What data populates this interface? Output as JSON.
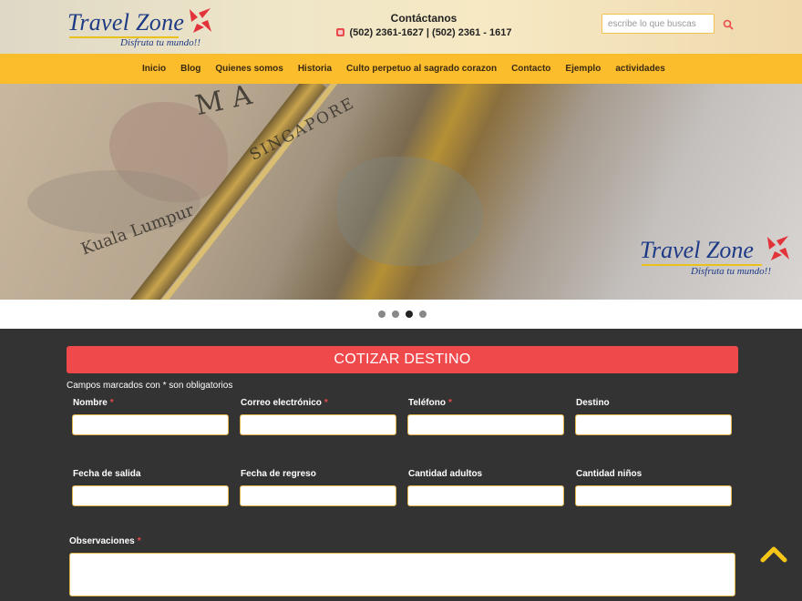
{
  "brand": {
    "name": "Travel Zone",
    "tagline": "Disfruta tu mundo!!"
  },
  "contact": {
    "title": "Contáctanos",
    "phones": "(502) 2361-1627 | (502) 2361 - 1617",
    "icon": "phone-icon"
  },
  "search": {
    "placeholder": "escribe lo que buscas",
    "icon": "search-icon"
  },
  "nav": {
    "items": [
      {
        "label": "Inicio"
      },
      {
        "label": "Blog"
      },
      {
        "label": "Quienes somos"
      },
      {
        "label": "Historia"
      },
      {
        "label": "Culto perpetuo al sagrado corazon"
      },
      {
        "label": "Contacto"
      },
      {
        "label": "Ejemplo"
      },
      {
        "label": "actividades"
      }
    ]
  },
  "hero": {
    "map_labels": [
      "MA",
      "Kuala Lumpur",
      "SINGAPORE"
    ]
  },
  "carousel": {
    "slides": 4,
    "active_index": 2
  },
  "form": {
    "title": "COTIZAR DESTINO",
    "required_note": "Campos marcados con * son obligatorios",
    "required_mark": "*",
    "fields": {
      "nombre": "Nombre",
      "correo": "Correo electrónico",
      "telefono": "Teléfono",
      "destino": "Destino",
      "fecha_salida": "Fecha de salida",
      "fecha_regreso": "Fecha de regreso",
      "adultos": "Cantidad adultos",
      "ninos": "Cantidad niños",
      "observaciones": "Observaciones"
    }
  },
  "colors": {
    "nav_bg": "#fbbd2b",
    "banner_bg": "#f0494c",
    "form_bg": "#333333",
    "brand_blue": "#1d3a86",
    "accent_red": "#e94b4b",
    "scroll_top": "#f5c518"
  },
  "scroll_top": {
    "icon": "chevron-up-icon"
  }
}
